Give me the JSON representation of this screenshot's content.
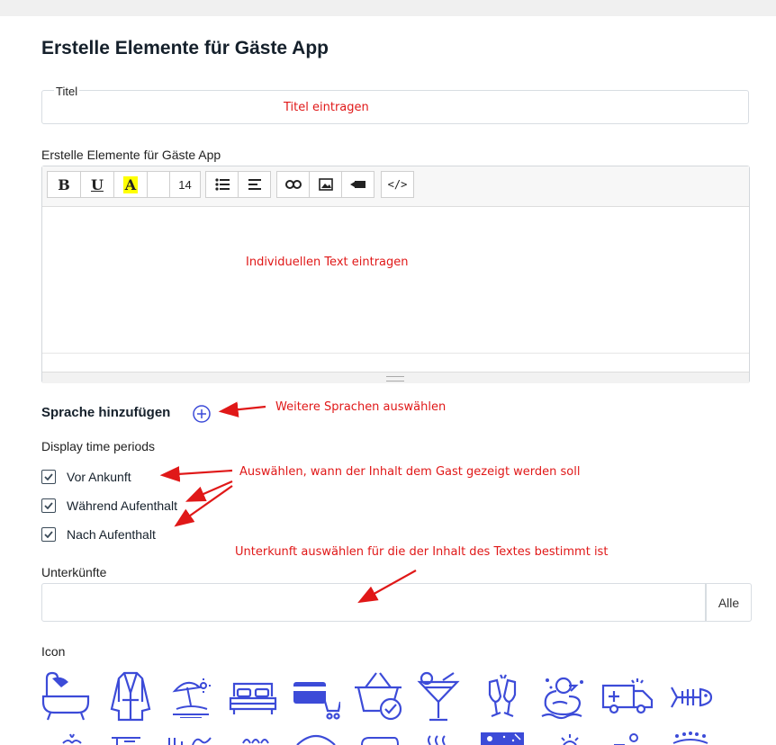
{
  "page_title": "Erstelle Elemente für Gäste App",
  "titel_field": {
    "label": "Titel",
    "value": ""
  },
  "editor": {
    "label": "Erstelle Elemente für Gäste App",
    "toolbar": {
      "bold": "B",
      "underline": "U",
      "highlight": "A",
      "font_size": "14"
    }
  },
  "annotations": {
    "titel": "Titel eintragen",
    "text": "Individuellen Text eintragen",
    "sprachen": "Weitere Sprachen auswählen",
    "zeitraum": "Auswählen, wann der Inhalt dem Gast gezeigt werden soll",
    "unterkunft": "Unterkunft auswählen für die der Inhalt des Textes bestimmt ist"
  },
  "language": {
    "label": "Sprache hinzufügen"
  },
  "time_periods": {
    "label": "Display time periods",
    "options": [
      {
        "label": "Vor Ankunft",
        "checked": true
      },
      {
        "label": "Während Aufenthalt",
        "checked": true
      },
      {
        "label": "Nach Aufenthalt",
        "checked": true
      }
    ]
  },
  "unterkuenfte": {
    "label": "Unterkünfte",
    "value": "",
    "all_button": "Alle"
  },
  "icons": {
    "label": "Icon",
    "row1": [
      "bathtub-icon",
      "bathrobe-icon",
      "beach-umbrella-icon",
      "bed-icon",
      "card-cart-icon",
      "basket-check-icon",
      "cocktail-icon",
      "champagne-icon",
      "rubber-duck-icon",
      "ambulance-icon",
      "fish-bone-icon"
    ],
    "accent": "#3c4bd8"
  },
  "colors": {
    "annotation": "#e01818",
    "icon": "#3c4bd8"
  }
}
